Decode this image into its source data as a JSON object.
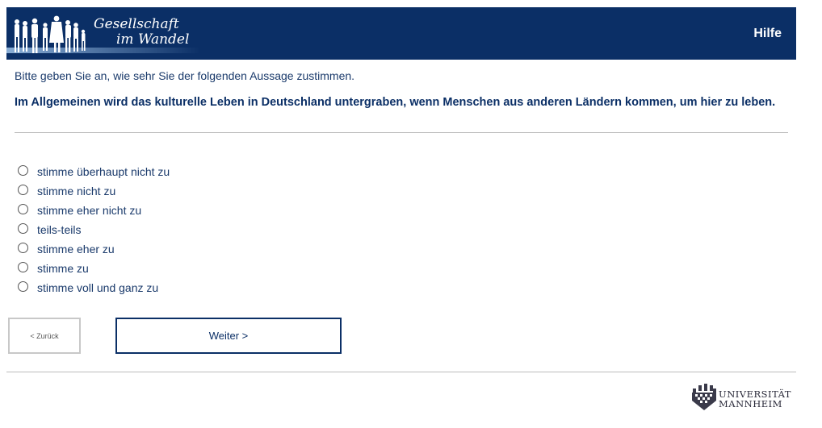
{
  "header": {
    "logo_line1": "Gesellschaft",
    "logo_line2": "im Wandel",
    "help_label": "Hilfe",
    "background_color": "#0b2f66"
  },
  "instruction": "Bitte geben Sie an, wie sehr Sie der folgenden Aussage zustimmen.",
  "question": "Im Allgemeinen wird das kulturelle Leben in Deutschland untergraben, wenn Menschen aus anderen Ländern kommen, um hier zu leben.",
  "options": [
    {
      "label": "stimme überhaupt nicht zu",
      "selected": false
    },
    {
      "label": "stimme nicht zu",
      "selected": false
    },
    {
      "label": "stimme eher nicht zu",
      "selected": false
    },
    {
      "label": "teils-teils",
      "selected": false
    },
    {
      "label": "stimme eher zu",
      "selected": false
    },
    {
      "label": "stimme zu",
      "selected": false
    },
    {
      "label": "stimme voll und ganz zu",
      "selected": false
    }
  ],
  "nav": {
    "back_label": "< Zurück",
    "next_label": "Weiter >"
  },
  "footer": {
    "university_line1": "UNIVERSITÄT",
    "university_line2": "MANNHEIM",
    "logo_icon": "castle-crest-icon"
  }
}
